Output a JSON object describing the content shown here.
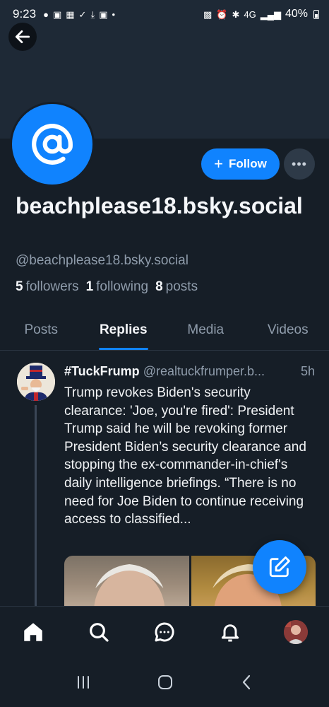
{
  "status_bar": {
    "time": "9:23",
    "network": "4G",
    "battery": "40%"
  },
  "profile": {
    "display_name": "beachplease18.bsky.social",
    "handle": "@beachplease18.bsky.social",
    "avatar_symbol": "@",
    "follow_label": "Follow",
    "more_label": "•••",
    "stats": {
      "followers_count": "5",
      "followers_label": "followers",
      "following_count": "1",
      "following_label": "following",
      "posts_count": "8",
      "posts_label": "posts"
    }
  },
  "tabs": [
    {
      "label": "Posts",
      "active": false
    },
    {
      "label": "Replies",
      "active": true
    },
    {
      "label": "Media",
      "active": false
    },
    {
      "label": "Videos",
      "active": false
    }
  ],
  "post": {
    "author_name": "#TuckFrump",
    "author_handle": "@realtuckfrumper.b...",
    "time": "5h",
    "text": "Trump revokes Biden's security clearance: 'Joe, you're fired': President Trump said he will be revoking former President Biden’s security clearance and stopping the ex-commander-in-chief's daily intelligence briefings. “There is no need for Joe Biden to continue receiving access to classified..."
  },
  "bottom_nav": [
    "home-icon",
    "search-icon",
    "chat-icon",
    "bell-icon",
    "profile-avatar"
  ],
  "colors": {
    "accent": "#1083fe",
    "background": "#161e27",
    "banner": "#1e2936",
    "muted_text": "#8f9cab"
  }
}
